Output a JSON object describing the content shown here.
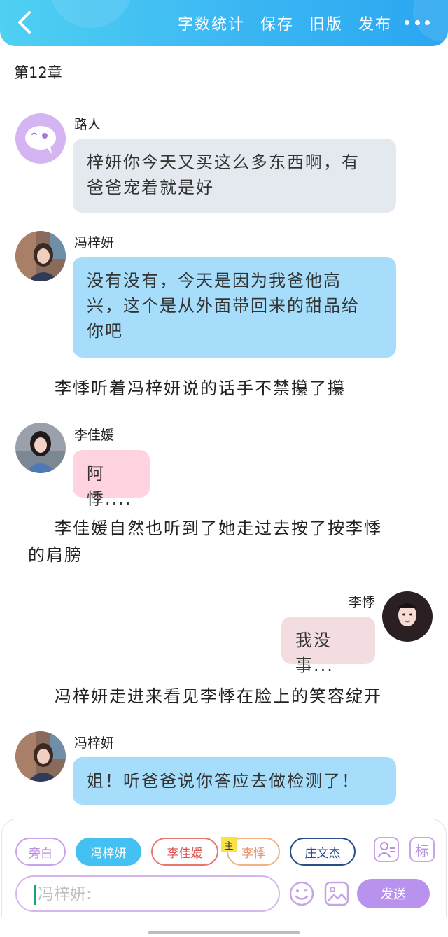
{
  "header": {
    "actions": [
      "字数统计",
      "保存",
      "旧版",
      "发布"
    ]
  },
  "chapter_title": "第12章",
  "messages": {
    "m1": {
      "sender": "路人",
      "text_line1": "梓妍你今天又买这么多东西啊，有",
      "text_line2": "爸爸宠着就是好"
    },
    "m2": {
      "sender": "冯梓妍",
      "text_line1": "没有没有，今天是因为我爸他高",
      "text_line2": "兴，这个是从外面带回来的甜品给",
      "text_line3": "你吧"
    },
    "n1": "李悸听着冯梓妍说的话手不禁攥了攥",
    "m3": {
      "sender": "李佳媛",
      "text": "阿悸...."
    },
    "n2_line1": "李佳媛自然也听到了她走过去按了按李悸",
    "n2_line2": "的肩膀",
    "m4": {
      "sender": "李悸",
      "text": "我没事..."
    },
    "n3": "冯梓妍走进来看见李悸在脸上的笑容绽开",
    "m5": {
      "sender": "冯梓妍",
      "text": "姐！听爸爸说你答应去做检测了！"
    }
  },
  "roles": {
    "narrator": "旁白",
    "feng": "冯梓妍",
    "jiayuan": "李佳媛",
    "liji": "李悸",
    "zhuang": "庄文杰",
    "main_badge": "主"
  },
  "tools": {
    "tag_label": "标"
  },
  "composer": {
    "placeholder": "冯梓妍:",
    "send_label": "发送"
  },
  "colors": {
    "header_start": "#4fd0f2",
    "header_end": "#2aa6f2",
    "bubble_gray": "#e4e8ef",
    "bubble_blue": "#a6ddfb",
    "bubble_pink": "#ffd3df",
    "bubble_rose": "#f4dde0",
    "send": "#b892ec"
  }
}
